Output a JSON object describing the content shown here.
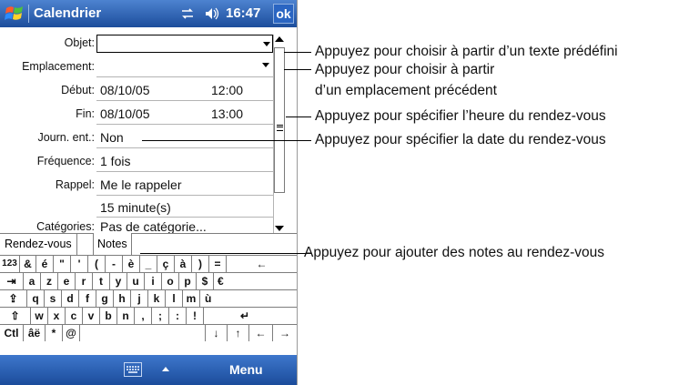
{
  "titlebar": {
    "app_title": "Calendrier",
    "clock": "16:47",
    "ok_label": "ok"
  },
  "form": {
    "fields": [
      {
        "label": "Objet:",
        "value": ""
      },
      {
        "label": "Emplacement:",
        "value": ""
      },
      {
        "label": "Début:",
        "value": "08/10/05",
        "time": "12:00"
      },
      {
        "label": "Fin:",
        "value": "08/10/05",
        "time": "13:00"
      },
      {
        "label": "Journ. ent.:",
        "value": "Non"
      },
      {
        "label": "Fréquence:",
        "value": "1 fois"
      },
      {
        "label": "Rappel:",
        "value": "Me le rappeler"
      },
      {
        "label": "",
        "value": "15     minute(s)"
      },
      {
        "label": "Catégories:",
        "value": "Pas de catégorie..."
      }
    ]
  },
  "tabs": {
    "rendezvous": "Rendez-vous",
    "notes": "Notes"
  },
  "keyboard": {
    "row1": [
      "123",
      "&",
      "é",
      "\"",
      "'",
      "(",
      "-",
      "è",
      "_",
      "ç",
      "à",
      ")",
      "=",
      "←"
    ],
    "row2": [
      "⇥",
      "a",
      "z",
      "e",
      "r",
      "t",
      "y",
      "u",
      "i",
      "o",
      "p",
      "$",
      "€"
    ],
    "row3": [
      "⇪",
      "q",
      "s",
      "d",
      "f",
      "g",
      "h",
      "j",
      "k",
      "l",
      "m",
      "ù"
    ],
    "row4": [
      "⇧",
      "w",
      "x",
      "c",
      "v",
      "b",
      "n",
      ",",
      ";",
      ":",
      "!",
      "↵"
    ],
    "row5": [
      "Ctl",
      "âë",
      "*",
      "@",
      "",
      "↓",
      "↑",
      "←",
      "→"
    ]
  },
  "menubar": {
    "menu_label": "Menu"
  },
  "annotations": [
    "Appuyez pour choisir à partir d’un texte prédéfini",
    "Appuyez pour choisir à partir",
    "d’un emplacement précédent",
    "Appuyez pour spécifier l’heure du rendez-vous",
    "Appuyez pour spécifier la date du rendez-vous",
    "Appuyez pour ajouter des notes au rendez-vous"
  ],
  "colors": {
    "titlebar": "#1c4d9c",
    "menubar": "#1b4c9b",
    "background": "#ffffff"
  }
}
